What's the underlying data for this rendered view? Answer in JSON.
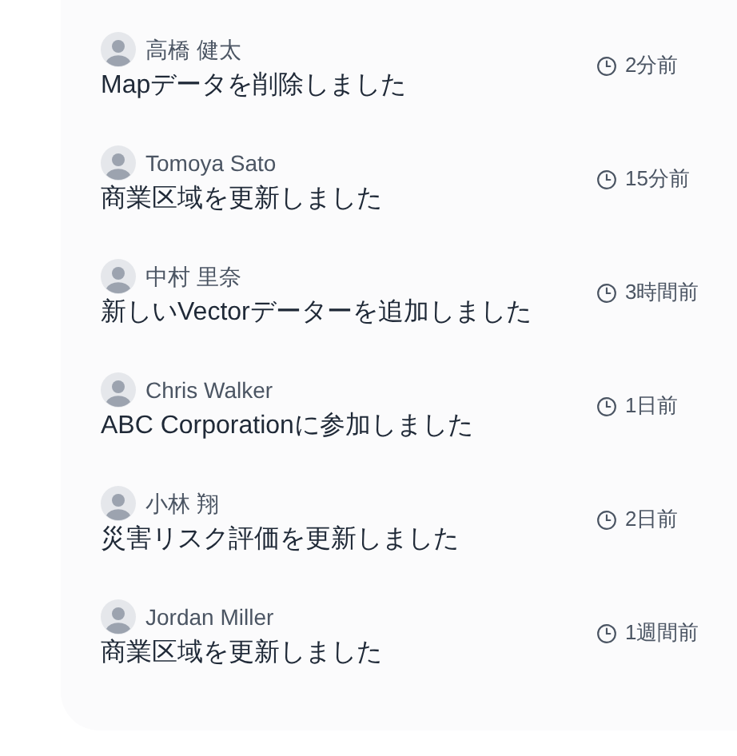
{
  "activities": [
    {
      "user": "高橋 健太",
      "action": "Mapデータを削除しました",
      "time": "2分前"
    },
    {
      "user": "Tomoya Sato",
      "action": "商業区域を更新しました",
      "time": "15分前"
    },
    {
      "user": "中村 里奈",
      "action": "新しいVectorデーターを追加しました",
      "time": "3時間前"
    },
    {
      "user": "Chris Walker",
      "action": "ABC Corporationに参加しました",
      "time": "1日前"
    },
    {
      "user": "小林 翔",
      "action": "災害リスク評価を更新しました",
      "time": "2日前"
    },
    {
      "user": "Jordan Miller",
      "action": "商業区域を更新しました",
      "time": "1週間前"
    }
  ]
}
